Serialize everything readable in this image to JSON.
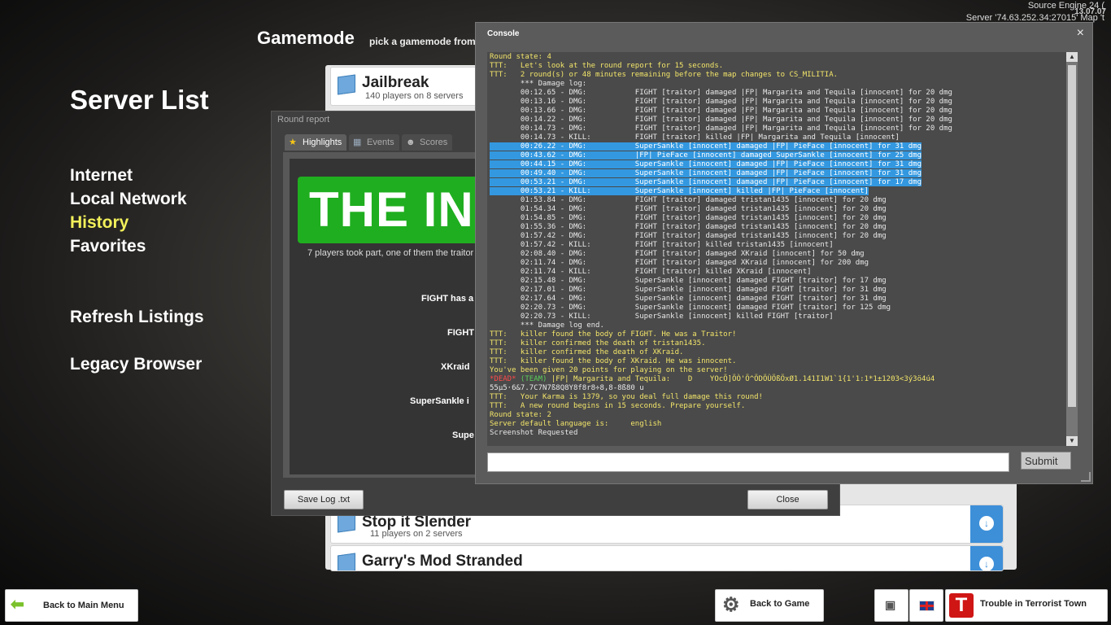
{
  "topinfo": {
    "engine": "Source Engine 24 (",
    "server": "Server '74.63.252.34:27015' Map 't",
    "date": "13.07.07"
  },
  "left": {
    "title": "Server List",
    "items": [
      "Internet",
      "Local Network",
      "History",
      "Favorites"
    ],
    "refresh": "Refresh Listings",
    "legacy": "Legacy Browser"
  },
  "gamemode": {
    "title": "Gamemode",
    "subtitle": "pick a gamemode from",
    "rows": [
      {
        "name": "Jailbreak",
        "count": "140 players on 8 servers"
      },
      {
        "name": "Stop it Slender",
        "count": "11 players on 2 servers"
      },
      {
        "name": "Garry's Mod Stranded",
        "count": ""
      }
    ]
  },
  "round_report": {
    "title": "Round report",
    "tabs": [
      "Highlights",
      "Events",
      "Scores"
    ],
    "banner": "THE INNOCENT",
    "summary": "7 players took part, one of them the traitor",
    "lines": [
      "FIGHT has a",
      "FIGHT",
      "XKraid",
      "SuperSankle i",
      "Supe"
    ],
    "save": "Save Log .txt",
    "close": "Close"
  },
  "console": {
    "title": "Console",
    "close": "×",
    "submit": "Submit",
    "log": [
      {
        "c": "y",
        "t": "Round state: 4"
      },
      {
        "c": "y",
        "t": "TTT:   Let's look at the round report for 15 seconds."
      },
      {
        "c": "y",
        "t": "TTT:   2 round(s) or 48 minutes remaining before the map changes to CS_MILITIA."
      },
      {
        "c": "w",
        "t": "       *** Damage log:"
      },
      {
        "c": "w",
        "t": "       00:12.65 - DMG:           FIGHT [traitor] damaged |FP| Margarita and Tequila [innocent] for 20 dmg"
      },
      {
        "c": "w",
        "t": "       00:13.16 - DMG:           FIGHT [traitor] damaged |FP| Margarita and Tequila [innocent] for 20 dmg"
      },
      {
        "c": "w",
        "t": "       00:13.66 - DMG:           FIGHT [traitor] damaged |FP| Margarita and Tequila [innocent] for 20 dmg"
      },
      {
        "c": "w",
        "t": "       00:14.22 - DMG:           FIGHT [traitor] damaged |FP| Margarita and Tequila [innocent] for 20 dmg"
      },
      {
        "c": "w",
        "t": "       00:14.73 - DMG:           FIGHT [traitor] damaged |FP| Margarita and Tequila [innocent] for 20 dmg"
      },
      {
        "c": "w",
        "t": "       00:14.73 - KILL:          FIGHT [traitor] killed |FP| Margarita and Tequila [innocent]"
      },
      {
        "c": "hl",
        "t": "       00:26.22 - DMG:           SuperSankle [innocent] damaged |FP| PieFace [innocent] for 31 dmg"
      },
      {
        "c": "hl",
        "t": "       00:43.62 - DMG:           |FP| PieFace [innocent] damaged SuperSankle [innocent] for 25 dmg"
      },
      {
        "c": "hl",
        "t": "       00:44.15 - DMG:           SuperSankle [innocent] damaged |FP| PieFace [innocent] for 31 dmg"
      },
      {
        "c": "hl",
        "t": "       00:49.40 - DMG:           SuperSankle [innocent] damaged |FP| PieFace [innocent] for 31 dmg"
      },
      {
        "c": "hl",
        "t": "       00:53.21 - DMG:           SuperSankle [innocent] damaged |FP| PieFace [innocent] for 17 dmg"
      },
      {
        "c": "hl",
        "t": "       00:53.21 - KILL:          SuperSankle [innocent] killed |FP| PieFace [innocent]"
      },
      {
        "c": "w",
        "t": "       01:53.84 - DMG:           FIGHT [traitor] damaged tristan1435 [innocent] for 20 dmg"
      },
      {
        "c": "w",
        "t": "       01:54.34 - DMG:           FIGHT [traitor] damaged tristan1435 [innocent] for 20 dmg"
      },
      {
        "c": "w",
        "t": "       01:54.85 - DMG:           FIGHT [traitor] damaged tristan1435 [innocent] for 20 dmg"
      },
      {
        "c": "w",
        "t": "       01:55.36 - DMG:           FIGHT [traitor] damaged tristan1435 [innocent] for 20 dmg"
      },
      {
        "c": "w",
        "t": "       01:57.42 - DMG:           FIGHT [traitor] damaged tristan1435 [innocent] for 20 dmg"
      },
      {
        "c": "w",
        "t": "       01:57.42 - KILL:          FIGHT [traitor] killed tristan1435 [innocent]"
      },
      {
        "c": "w",
        "t": "       02:08.40 - DMG:           FIGHT [traitor] damaged XKraid [innocent] for 50 dmg"
      },
      {
        "c": "w",
        "t": "       02:11.74 - DMG:           FIGHT [traitor] damaged XKraid [innocent] for 200 dmg"
      },
      {
        "c": "w",
        "t": "       02:11.74 - KILL:          FIGHT [traitor] killed XKraid [innocent]"
      },
      {
        "c": "w",
        "t": "       02:15.48 - DMG:           SuperSankle [innocent] damaged FIGHT [traitor] for 17 dmg"
      },
      {
        "c": "w",
        "t": "       02:17.01 - DMG:           SuperSankle [innocent] damaged FIGHT [traitor] for 31 dmg"
      },
      {
        "c": "w",
        "t": "       02:17.64 - DMG:           SuperSankle [innocent] damaged FIGHT [traitor] for 31 dmg"
      },
      {
        "c": "w",
        "t": "       02:20.73 - DMG:           SuperSankle [innocent] damaged FIGHT [traitor] for 125 dmg"
      },
      {
        "c": "w",
        "t": "       02:20.73 - KILL:          SuperSankle [innocent] killed FIGHT [traitor]"
      },
      {
        "c": "w",
        "t": "       *** Damage log end."
      },
      {
        "c": "y",
        "t": "TTT:   killer found the body of FIGHT. He was a Traitor!"
      },
      {
        "c": "y",
        "t": "TTT:   killer confirmed the death of tristan1435."
      },
      {
        "c": "y",
        "t": "TTT:   killer confirmed the death of XKraid."
      },
      {
        "c": "y",
        "t": "TTT:   killer found the body of XKraid. He was innocent."
      },
      {
        "c": "y",
        "t": "You've been given 20 points for playing on the server!"
      },
      {
        "c": "mix",
        "a": "*DEAD*",
        "b": " (TEAM)",
        "t": " |FP| Margarita and Tequila:    D    YOcÕ]ÖÒ'Ö^ÖDÖÙÖßÖxØ1.141I1W1`1{1'1:1*1±1203<3ý3ö4ú4"
      },
      {
        "c": "w",
        "t": "55µ5·6&7.7C7N7ß8Q8Y8f8r8÷8,8-8ß80 u"
      },
      {
        "c": "y",
        "t": "TTT:   Your Karma is 1379, so you deal full damage this round!"
      },
      {
        "c": "y",
        "t": "TTT:   A new round begins in 15 seconds. Prepare yourself."
      },
      {
        "c": "y",
        "t": "Round state: 2"
      },
      {
        "c": "y",
        "t": "Server default language is:     english"
      },
      {
        "c": "w",
        "t": "Screenshot Requested"
      }
    ]
  },
  "bottom": {
    "back_main": "Back to Main Menu",
    "back_game": "Back to Game",
    "gamemode": "Trouble in Terrorist Town"
  }
}
